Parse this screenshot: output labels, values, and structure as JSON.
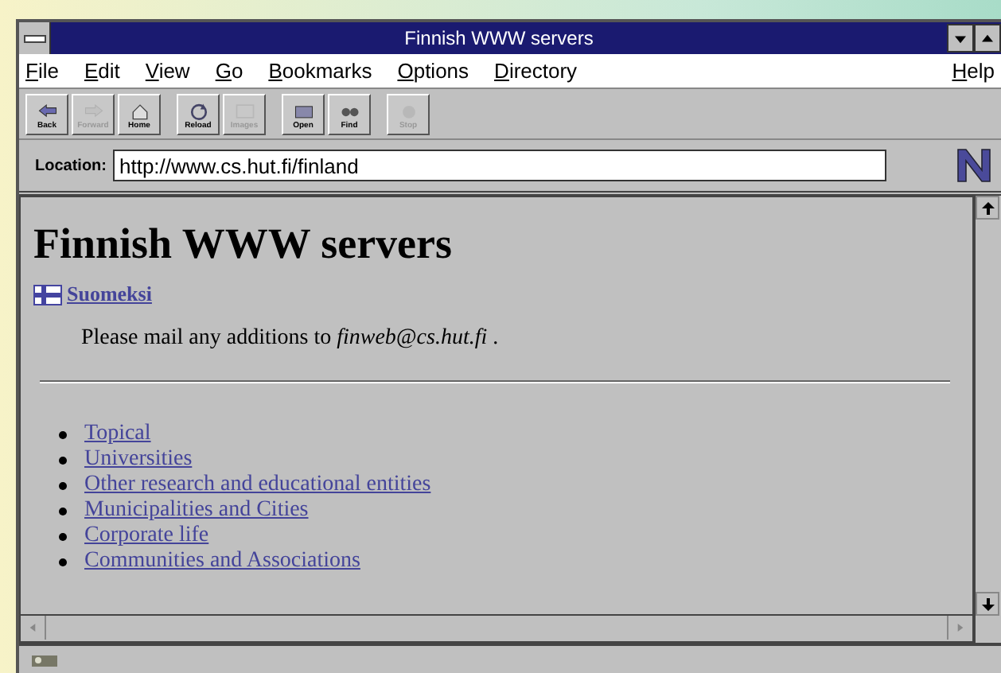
{
  "window": {
    "title": "Finnish WWW servers"
  },
  "menu": [
    {
      "label": "File"
    },
    {
      "label": "Edit"
    },
    {
      "label": "View"
    },
    {
      "label": "Go"
    },
    {
      "label": "Bookmarks"
    },
    {
      "label": "Options"
    },
    {
      "label": "Directory"
    },
    {
      "label": "Help"
    }
  ],
  "toolbar": [
    {
      "kind": "button",
      "label": "Back",
      "disabled": false
    },
    {
      "kind": "button",
      "label": "Forward",
      "disabled": true
    },
    {
      "kind": "button",
      "label": "Home",
      "disabled": false
    },
    {
      "kind": "separator"
    },
    {
      "kind": "button",
      "label": "Reload",
      "disabled": false
    },
    {
      "kind": "button",
      "label": "Images",
      "disabled": true
    },
    {
      "kind": "separator"
    },
    {
      "kind": "button",
      "label": "Open",
      "disabled": false
    },
    {
      "kind": "button",
      "label": "Find",
      "disabled": false
    },
    {
      "kind": "separator"
    },
    {
      "kind": "button",
      "label": "Stop",
      "disabled": true
    }
  ],
  "location": {
    "label": "Location:",
    "value": "http://www.cs.hut.fi/finland"
  },
  "page": {
    "heading": "Finnish WWW servers",
    "language_link": "Suomeksi",
    "mail_note": "Please mail any additions to *finweb@cs.hut.fi* .",
    "links": [
      "Topical",
      "Universities",
      "Other research and educational entities",
      "Municipalities and Cities",
      "Corporate life",
      "Communities and Associations"
    ]
  }
}
